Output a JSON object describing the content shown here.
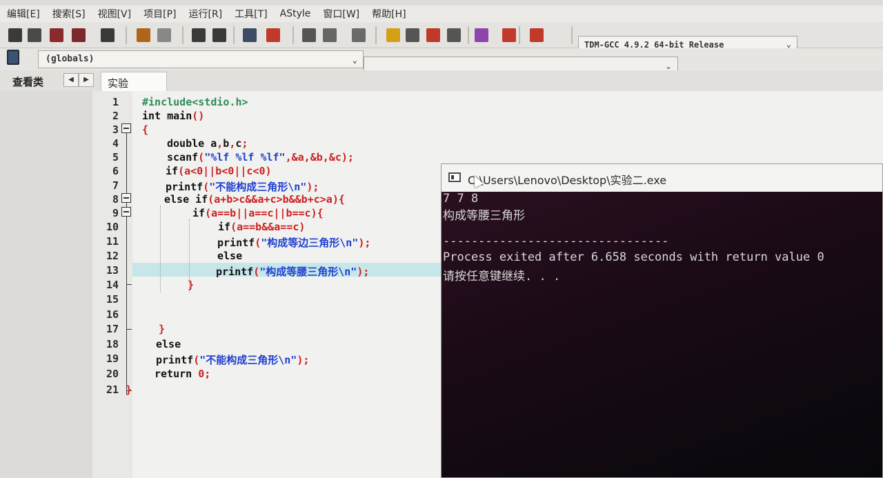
{
  "menu": [
    "编辑[E]",
    "搜索[S]",
    "视图[V]",
    "项目[P]",
    "运行[R]",
    "工具[T]",
    "AStyle",
    "窗口[W]",
    "帮助[H]"
  ],
  "toolbar": {
    "compiler": "TDM-GCC 4.9.2 64-bit Release",
    "icons": [
      "new-icon",
      "open-icon",
      "save-icon",
      "save-all-icon",
      "print-icon",
      "undo-icon",
      "redo-icon",
      "find-icon",
      "replace-icon",
      "indent-icon",
      "unindent-icon",
      "bookmark-icon",
      "goto-icon",
      "layout-icon",
      "window-icon",
      "color-icon",
      "grid-icon",
      "check-icon",
      "close-icon",
      "chart-icon",
      "debug-icon"
    ]
  },
  "scope": {
    "value": "(globals)"
  },
  "tabs": {
    "class_view": "查看类",
    "file": "实验二.cpp"
  },
  "code_lines": [
    {
      "n": "1",
      "parts": [
        {
          "t": "#include<stdio.h>",
          "c": "pp"
        }
      ]
    },
    {
      "n": "2",
      "parts": [
        {
          "t": "int main",
          "c": "kw"
        },
        {
          "t": "()",
          "c": "op"
        }
      ]
    },
    {
      "n": "3",
      "parts": [
        {
          "t": "{",
          "c": "op"
        }
      ]
    },
    {
      "n": "4",
      "parts": [
        {
          "t": "double a",
          "c": "kw"
        },
        {
          "t": ",",
          "c": "op"
        },
        {
          "t": "b",
          "c": "kw"
        },
        {
          "t": ",",
          "c": "op"
        },
        {
          "t": "c",
          "c": "kw"
        },
        {
          "t": ";",
          "c": "op"
        }
      ]
    },
    {
      "n": "5",
      "parts": [
        {
          "t": "scanf",
          "c": "kw"
        },
        {
          "t": "(",
          "c": "op"
        },
        {
          "t": "\"%lf %lf %lf\"",
          "c": "str"
        },
        {
          "t": ",&a,&b,&c);",
          "c": "op"
        }
      ]
    },
    {
      "n": "6",
      "parts": [
        {
          "t": "if",
          "c": "kw"
        },
        {
          "t": "(a<0||b<0||c<0)",
          "c": "op"
        }
      ]
    },
    {
      "n": "7",
      "parts": [
        {
          "t": "printf",
          "c": "kw"
        },
        {
          "t": "(",
          "c": "op"
        },
        {
          "t": "\"不能构成三角形\\n\"",
          "c": "str"
        },
        {
          "t": ");",
          "c": "op"
        }
      ]
    },
    {
      "n": "8",
      "parts": [
        {
          "t": "else if",
          "c": "kw"
        },
        {
          "t": "(a+b>c&&a+c>b&&b+c>a){",
          "c": "op"
        }
      ]
    },
    {
      "n": "9",
      "parts": [
        {
          "t": "if",
          "c": "kw"
        },
        {
          "t": "(a==b||a==c||b==c){",
          "c": "op"
        }
      ]
    },
    {
      "n": "10",
      "parts": [
        {
          "t": "if",
          "c": "kw"
        },
        {
          "t": "(a==b&&a==c)",
          "c": "op"
        }
      ]
    },
    {
      "n": "11",
      "parts": [
        {
          "t": "printf",
          "c": "kw"
        },
        {
          "t": "(",
          "c": "op"
        },
        {
          "t": "\"构成等边三角形\\n\"",
          "c": "str"
        },
        {
          "t": ");",
          "c": "op"
        }
      ]
    },
    {
      "n": "12",
      "parts": [
        {
          "t": "else",
          "c": "kw"
        }
      ]
    },
    {
      "n": "13",
      "parts": [
        {
          "t": "printf",
          "c": "kw"
        },
        {
          "t": "(",
          "c": "op"
        },
        {
          "t": "\"构成等腰三角形\\n\"",
          "c": "str"
        },
        {
          "t": ");",
          "c": "op"
        }
      ]
    },
    {
      "n": "14",
      "parts": [
        {
          "t": "}",
          "c": "op"
        }
      ]
    },
    {
      "n": "15",
      "parts": []
    },
    {
      "n": "16",
      "parts": []
    },
    {
      "n": "17",
      "parts": [
        {
          "t": "}",
          "c": "op"
        }
      ]
    },
    {
      "n": "18",
      "parts": [
        {
          "t": "else",
          "c": "kw"
        }
      ]
    },
    {
      "n": "19",
      "parts": [
        {
          "t": "printf",
          "c": "kw"
        },
        {
          "t": "(",
          "c": "op"
        },
        {
          "t": "\"不能构成三角形\\n\"",
          "c": "str"
        },
        {
          "t": ");",
          "c": "op"
        }
      ]
    },
    {
      "n": "20",
      "parts": [
        {
          "t": "return ",
          "c": "kw"
        },
        {
          "t": "0;",
          "c": "op"
        }
      ]
    },
    {
      "n": "21",
      "parts": [
        {
          "t": "}",
          "c": "op"
        }
      ]
    }
  ],
  "console": {
    "title": "C:\\Users\\Lenovo\\Desktop\\实验二.exe",
    "lines": [
      "7 7 8",
      "构成等腰三角形",
      "",
      "--------------------------------",
      "Process exited after 6.658 seconds with return value 0",
      "请按任意键继续. . ."
    ]
  }
}
